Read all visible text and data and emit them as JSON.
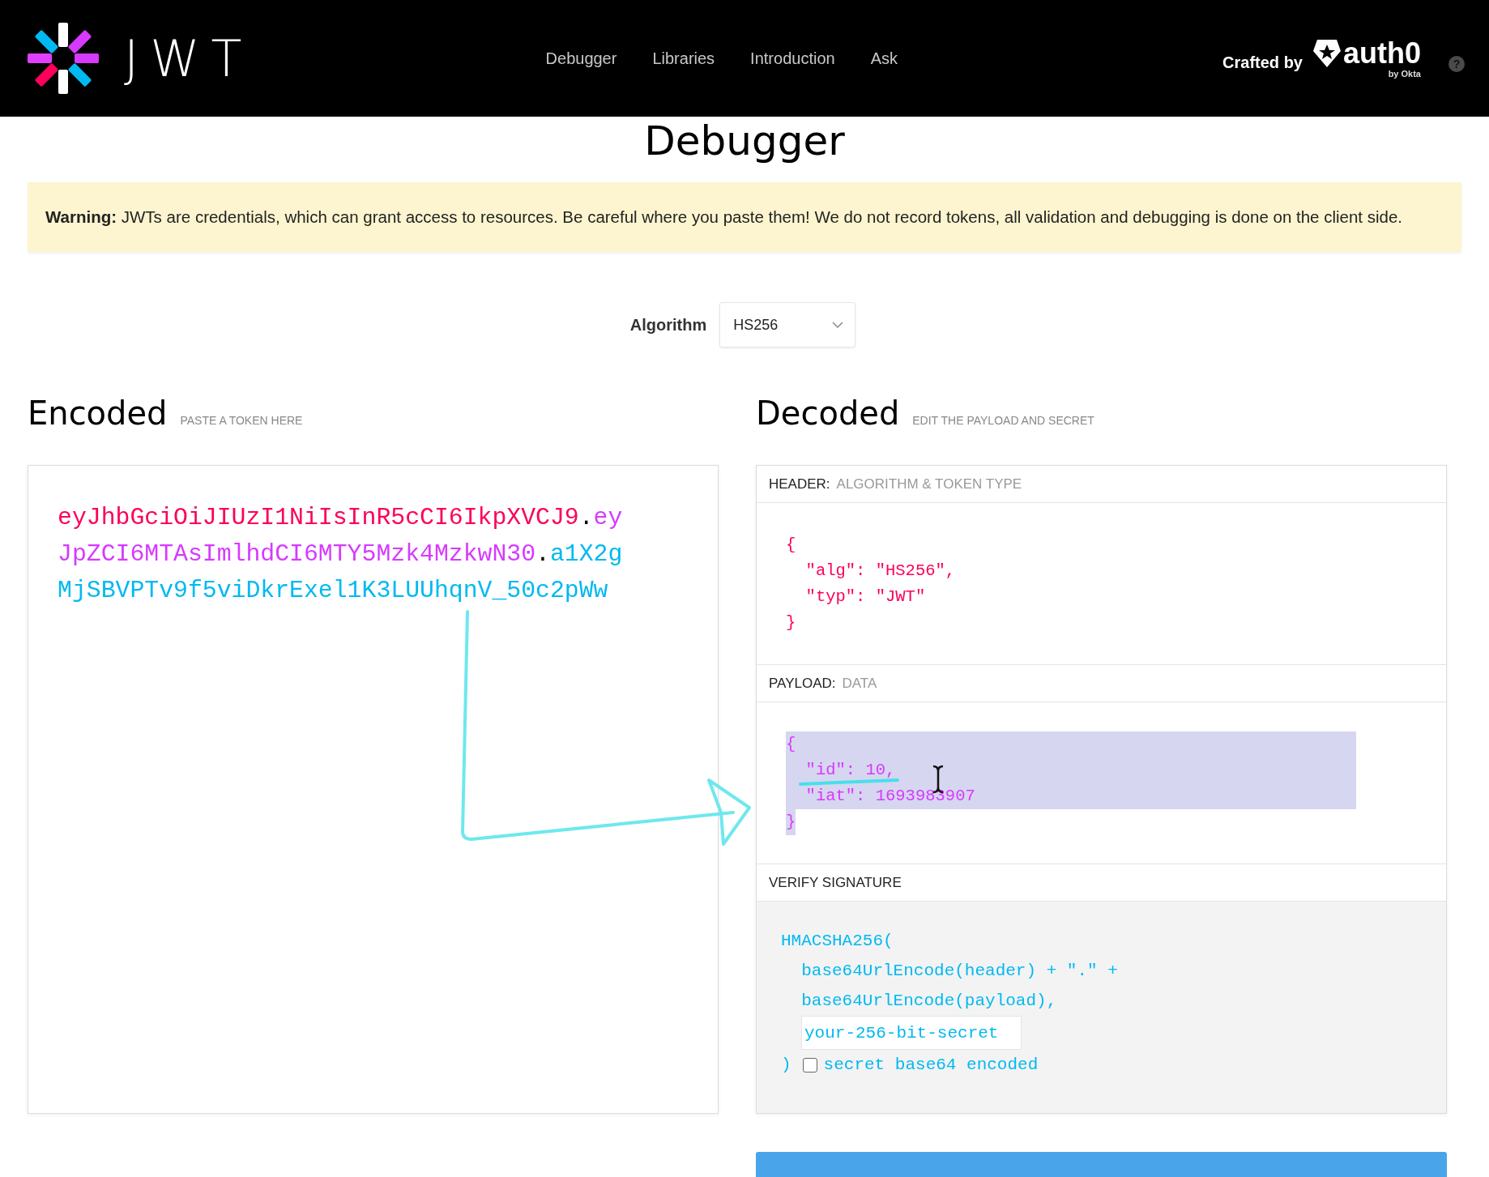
{
  "nav": {
    "logo_text": "JWT",
    "links": [
      {
        "label": "Debugger"
      },
      {
        "label": "Libraries"
      },
      {
        "label": "Introduction"
      },
      {
        "label": "Ask"
      }
    ],
    "crafted_by": "Crafted by",
    "brand": "auth0",
    "brand_sub": "by Okta",
    "help": "?"
  },
  "page_title": "Debugger",
  "warning": "**Warning:** JWTs are credentials, which can grant access to resources. Be careful where you paste them! We do not record tokens, all validation and debugging is done on the client side.",
  "algorithm": {
    "label": "Algorithm",
    "value": "HS256"
  },
  "encoded": {
    "title": "Encoded",
    "hint": "PASTE A TOKEN HERE",
    "lines": [
      [
        {
          "text": "eyJhbGciOiJIUzI1NiIsInR5cCI6IkpXVCJ9",
          "kind": "header"
        },
        {
          "text": ".",
          "kind": "dot"
        },
        {
          "text": "ey",
          "kind": "payload"
        }
      ],
      [
        {
          "text": "JpZCI6MTAsImlhdCI6MTY5Mzk4MzkwN30",
          "kind": "payload"
        },
        {
          "text": ".",
          "kind": "dot"
        },
        {
          "text": "a1X2g",
          "kind": "signature"
        }
      ],
      [
        {
          "text": "MjSBVPTv9f5viDkrExel1K3LUUhqnV_50c2pWw",
          "kind": "signature"
        }
      ]
    ]
  },
  "decoded": {
    "title": "Decoded",
    "hint": "EDIT THE PAYLOAD AND SECRET",
    "sections": [
      {
        "kind": "header",
        "label": "HEADER:",
        "sublabel": "ALGORITHM & TOKEN TYPE",
        "selected": false,
        "lines": [
          "{",
          "  \"alg\": \"HS256\",",
          "  \"typ\": \"JWT\"",
          "}"
        ]
      },
      {
        "kind": "payload",
        "label": "PAYLOAD:",
        "sublabel": "DATA",
        "selected": true,
        "lines": [
          "{",
          "  \"id\": 10,",
          "  \"iat\": 1693983907",
          "}"
        ]
      },
      {
        "kind": "verify",
        "label": "VERIFY SIGNATURE",
        "lines": [
          "HMACSHA256(",
          "  base64UrlEncode(header) + \".\" +",
          "  base64UrlEncode(payload),"
        ],
        "secret": {
          "value": "your-256-bit-secret"
        },
        "close": ")",
        "checkbox": {
          "label": "secret base64 encoded",
          "checked": false
        }
      }
    ]
  }
}
